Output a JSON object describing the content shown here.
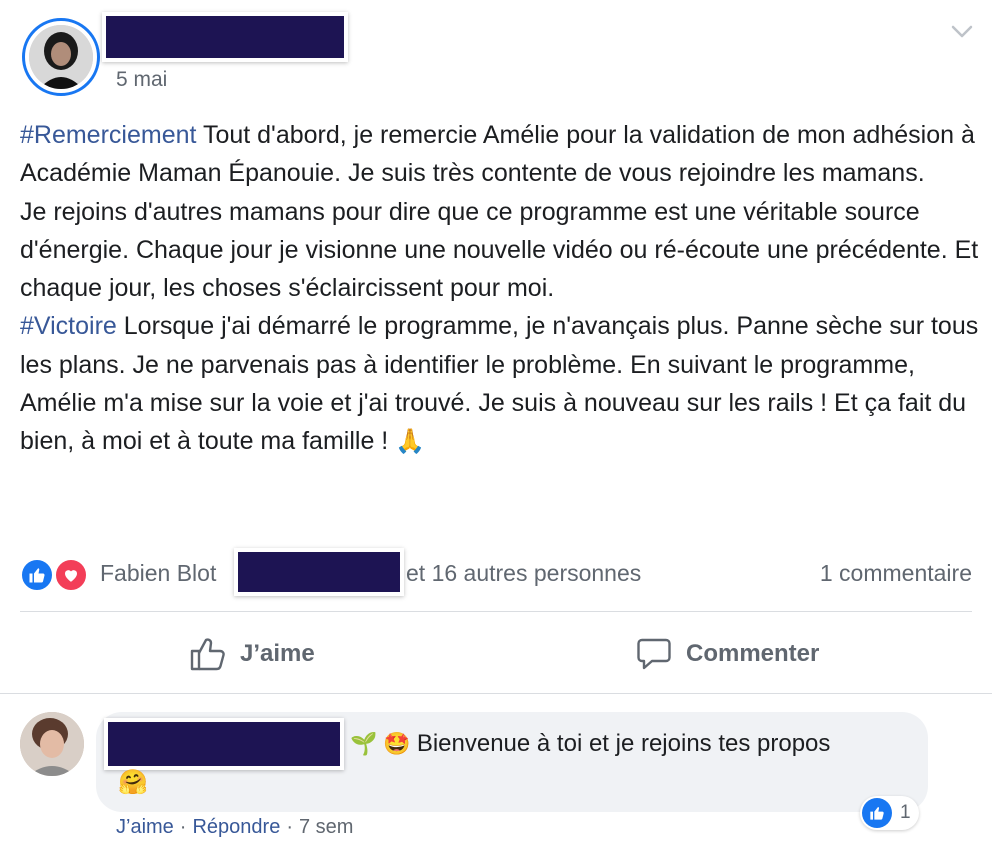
{
  "post": {
    "date": "5 mai",
    "paragraphs": [
      {
        "hashtag": "#Remerciement",
        "text": " Tout d'abord, je remercie Amélie pour la validation de mon adhésion à Académie Maman Épanouie. Je suis très contente de vous rejoindre les mamans."
      },
      {
        "hashtag": "",
        "text": "Je rejoins d'autres mamans pour dire que ce programme est une véritable source d'énergie. Chaque jour je visionne une nouvelle vidéo ou ré-écoute une précédente. Et chaque jour, les choses s'éclaircissent pour moi."
      },
      {
        "hashtag": "#Victoire",
        "text": " Lorsque j'ai démarré le programme, je n'avançais plus. Panne sèche sur tous les plans. Je ne parvenais pas à identifier le problème. En suivant le programme, Amélie m'a mise sur la voie et j'ai trouvé. Je suis à nouveau sur les rails ! Et ça fait du bien, à moi et à toute ma famille !",
        "emoji": "🙏"
      }
    ]
  },
  "reactions": {
    "first_name": "Fabien Blot",
    "others": "et 16 autres personnes",
    "comment_count": "1 commentaire"
  },
  "actions": {
    "like_label": "J’aime",
    "comment_label": "Commenter"
  },
  "comment": {
    "prefix_emoji_1": "🌱",
    "prefix_emoji_2": "🤩",
    "text": "Bienvenue à toi et je rejoins tes propos",
    "trailing_emoji": "🤗",
    "reaction_count": "1",
    "like_label": "J’aime",
    "reply_label": "Répondre",
    "time": "7 sem",
    "separator": "·"
  },
  "colors": {
    "accent_blue": "#1877f2",
    "hashtag": "#385898",
    "love_red": "#f33e58",
    "redaction": "#1d1453",
    "bubble_bg": "#f0f2f5"
  }
}
